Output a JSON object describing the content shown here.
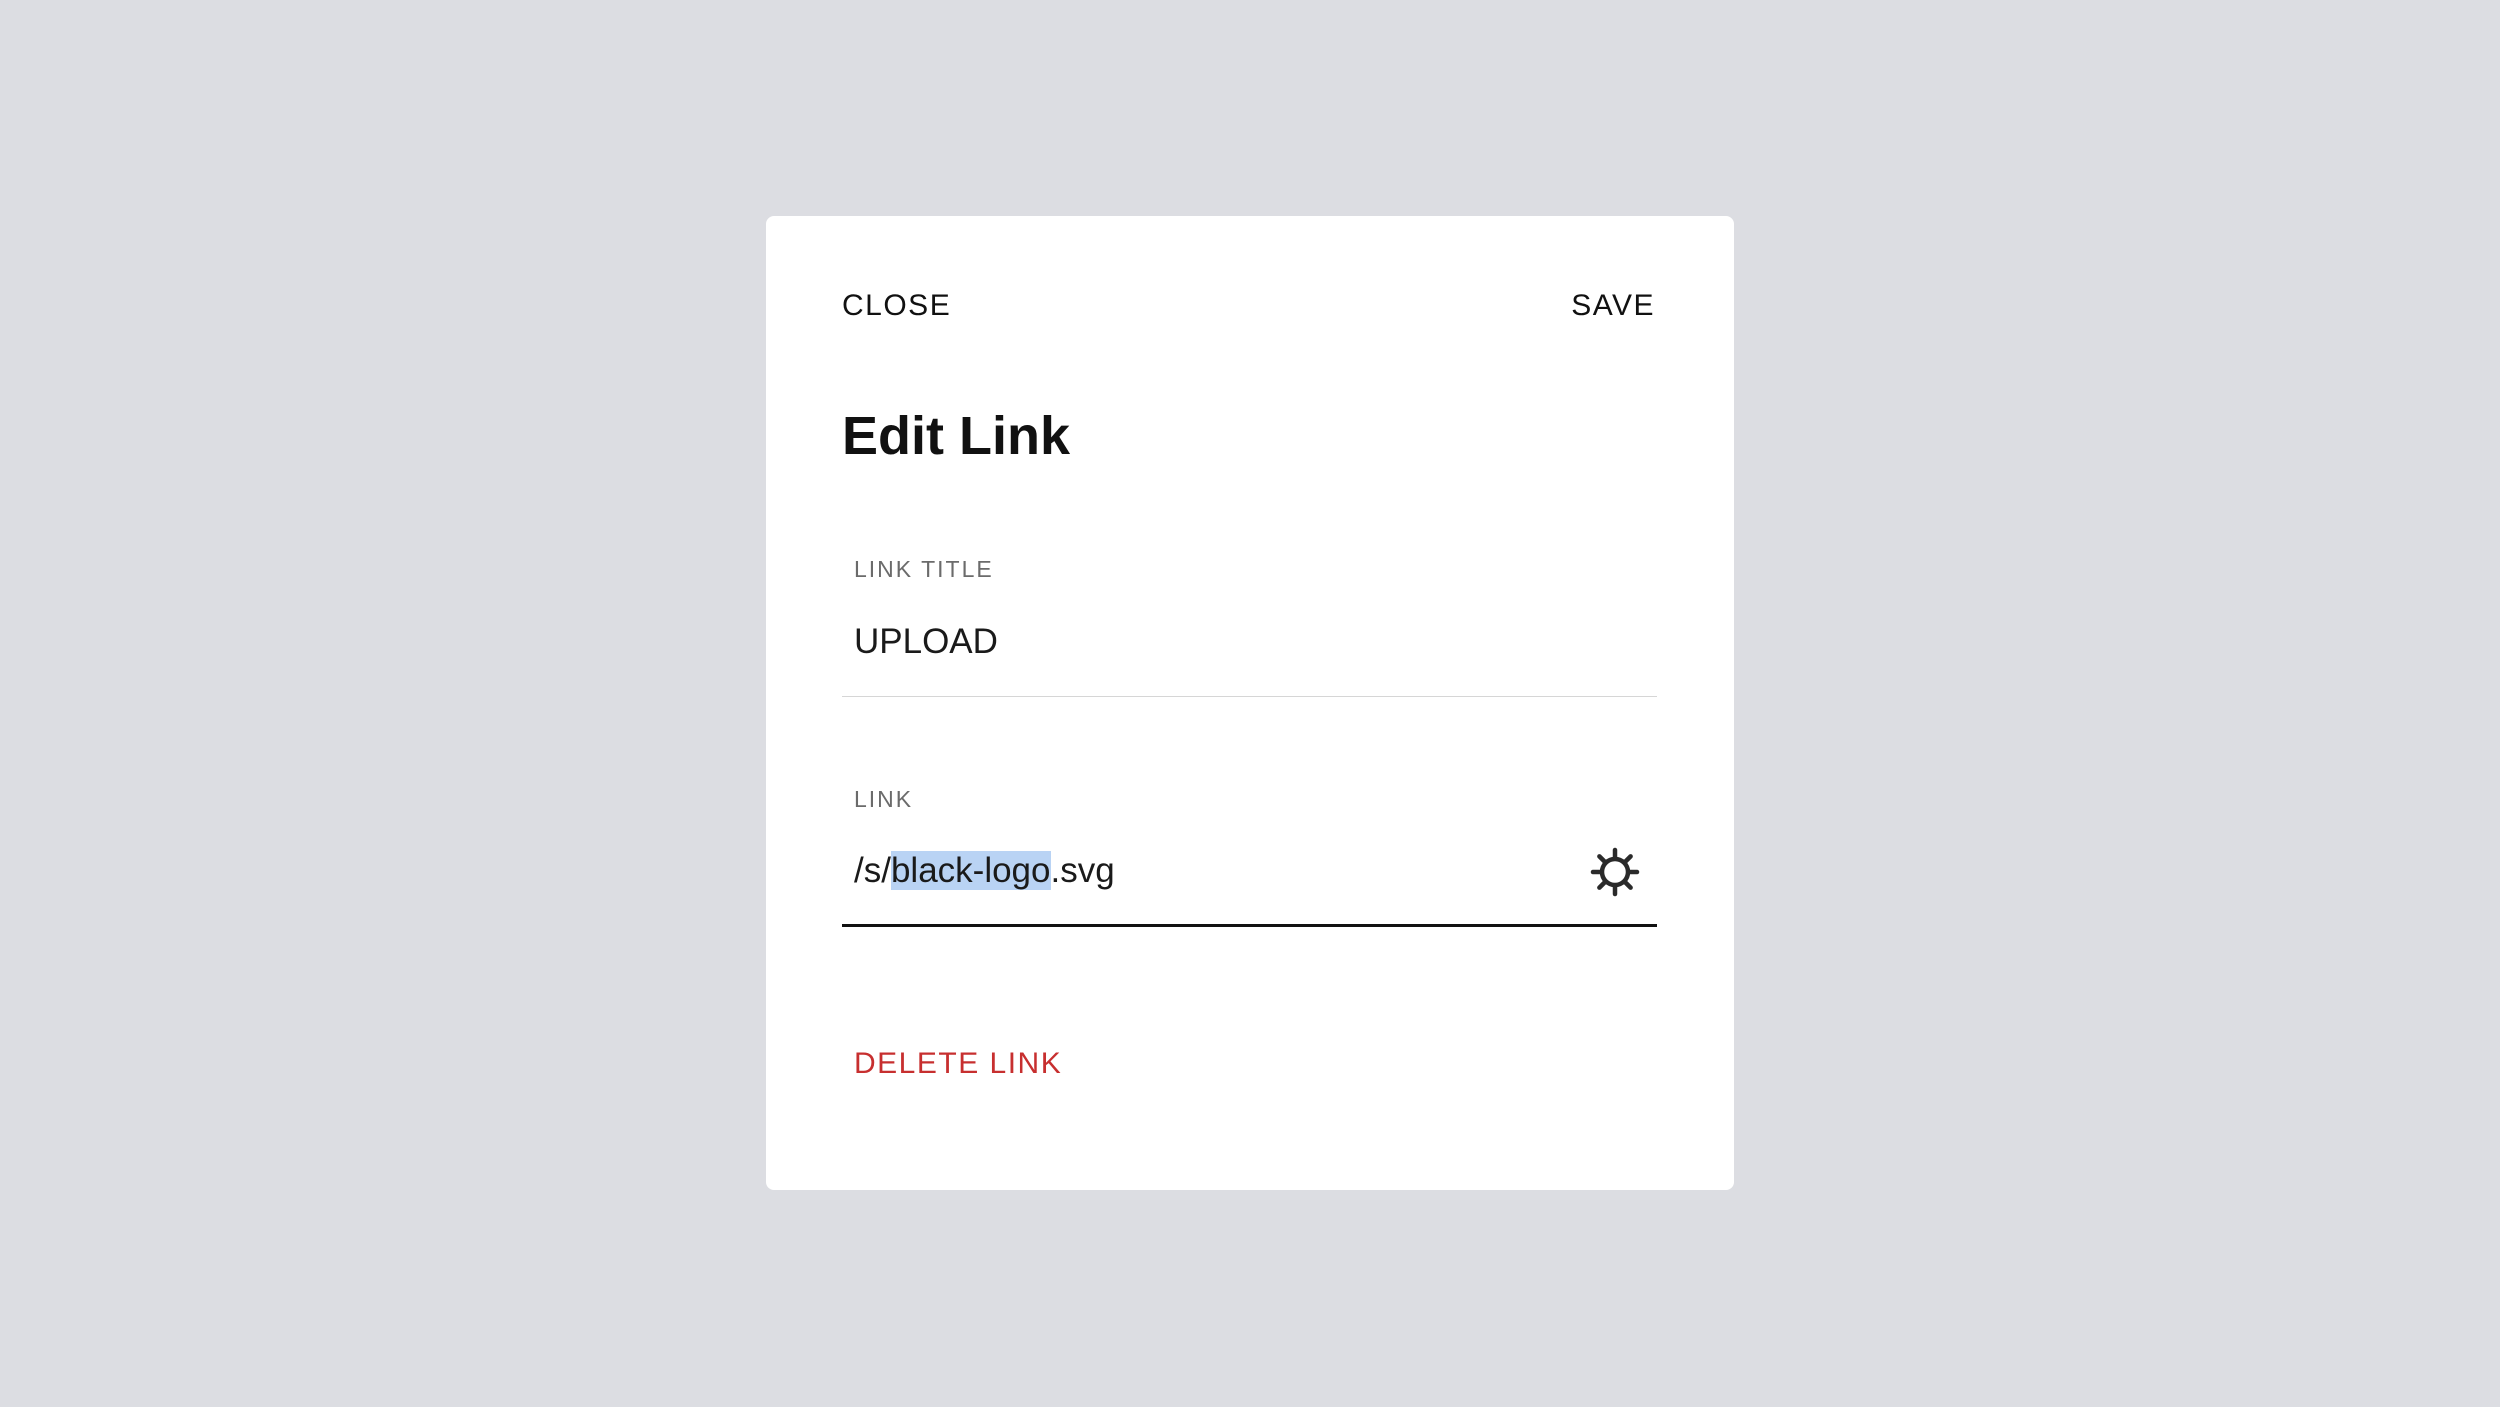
{
  "modal": {
    "close_label": "CLOSE",
    "save_label": "SAVE",
    "title": "Edit Link",
    "link_title": {
      "label": "LINK TITLE",
      "value": "UPLOAD"
    },
    "link": {
      "label": "LINK",
      "value_prefix": "/s/",
      "value_selected": "black-logo",
      "value_suffix": ".svg",
      "settings_icon": "gear-icon"
    },
    "delete_label": "DELETE LINK"
  },
  "colors": {
    "background": "#dcdde2",
    "panel": "#ffffff",
    "text": "#111111",
    "label": "#6b6b6b",
    "selection": "#b9d3f4",
    "danger": "#c72f2f"
  }
}
